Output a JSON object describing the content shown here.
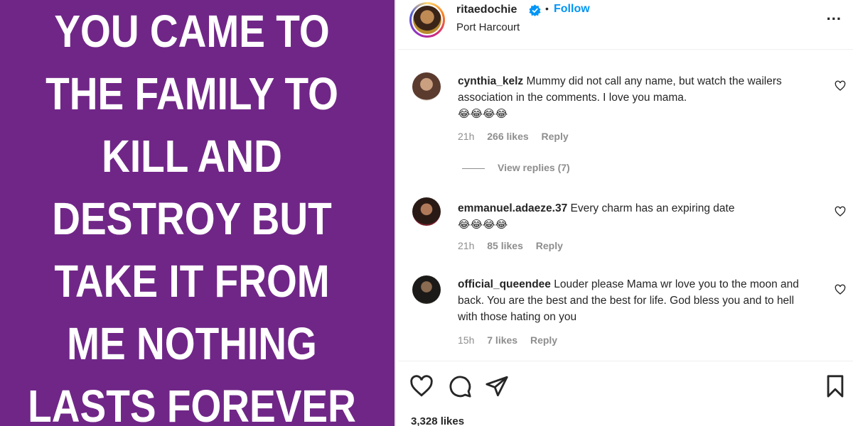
{
  "post_image": {
    "background": "#702687",
    "lines": [
      "YOU CAME TO",
      "THE FAMILY TO",
      "KILL AND",
      "DESTROY BUT",
      "TAKE IT FROM",
      "ME NOTHING",
      "LASTS FOREVER"
    ]
  },
  "header": {
    "username": "ritaedochie",
    "dot": "•",
    "follow_label": "Follow",
    "location": "Port Harcourt",
    "more_label": "..."
  },
  "comments": [
    {
      "user": "cynthia_kelz",
      "text": "Mummy did not call any name, but watch the wailers association in the comments. I love you mama.",
      "emojis": "😂😂😂😂",
      "time": "21h",
      "likes": "266 likes",
      "reply_label": "Reply"
    },
    {
      "user": "emmanuel.adaeze.37",
      "text": "Every charm has an expiring date",
      "emojis": "😂😂😂😂",
      "time": "21h",
      "likes": "85 likes",
      "reply_label": "Reply"
    },
    {
      "user": "official_queendee",
      "text": "Louder please Mama wr love you to the moon and back. You are the best and the best for life. God bless you and to hell with those hating on you",
      "emojis": "",
      "time": "15h",
      "likes": "7 likes",
      "reply_label": "Reply"
    }
  ],
  "view_replies_label": "View replies (7)",
  "likes_total": "3,328 likes",
  "icons": {
    "like": "heart-icon",
    "comment": "comment-icon",
    "share": "share-icon",
    "save": "bookmark-icon",
    "verified": "verified-badge-icon"
  },
  "colors": {
    "accent": "#0095f6",
    "muted": "#8e8e8e",
    "text": "#262626"
  }
}
